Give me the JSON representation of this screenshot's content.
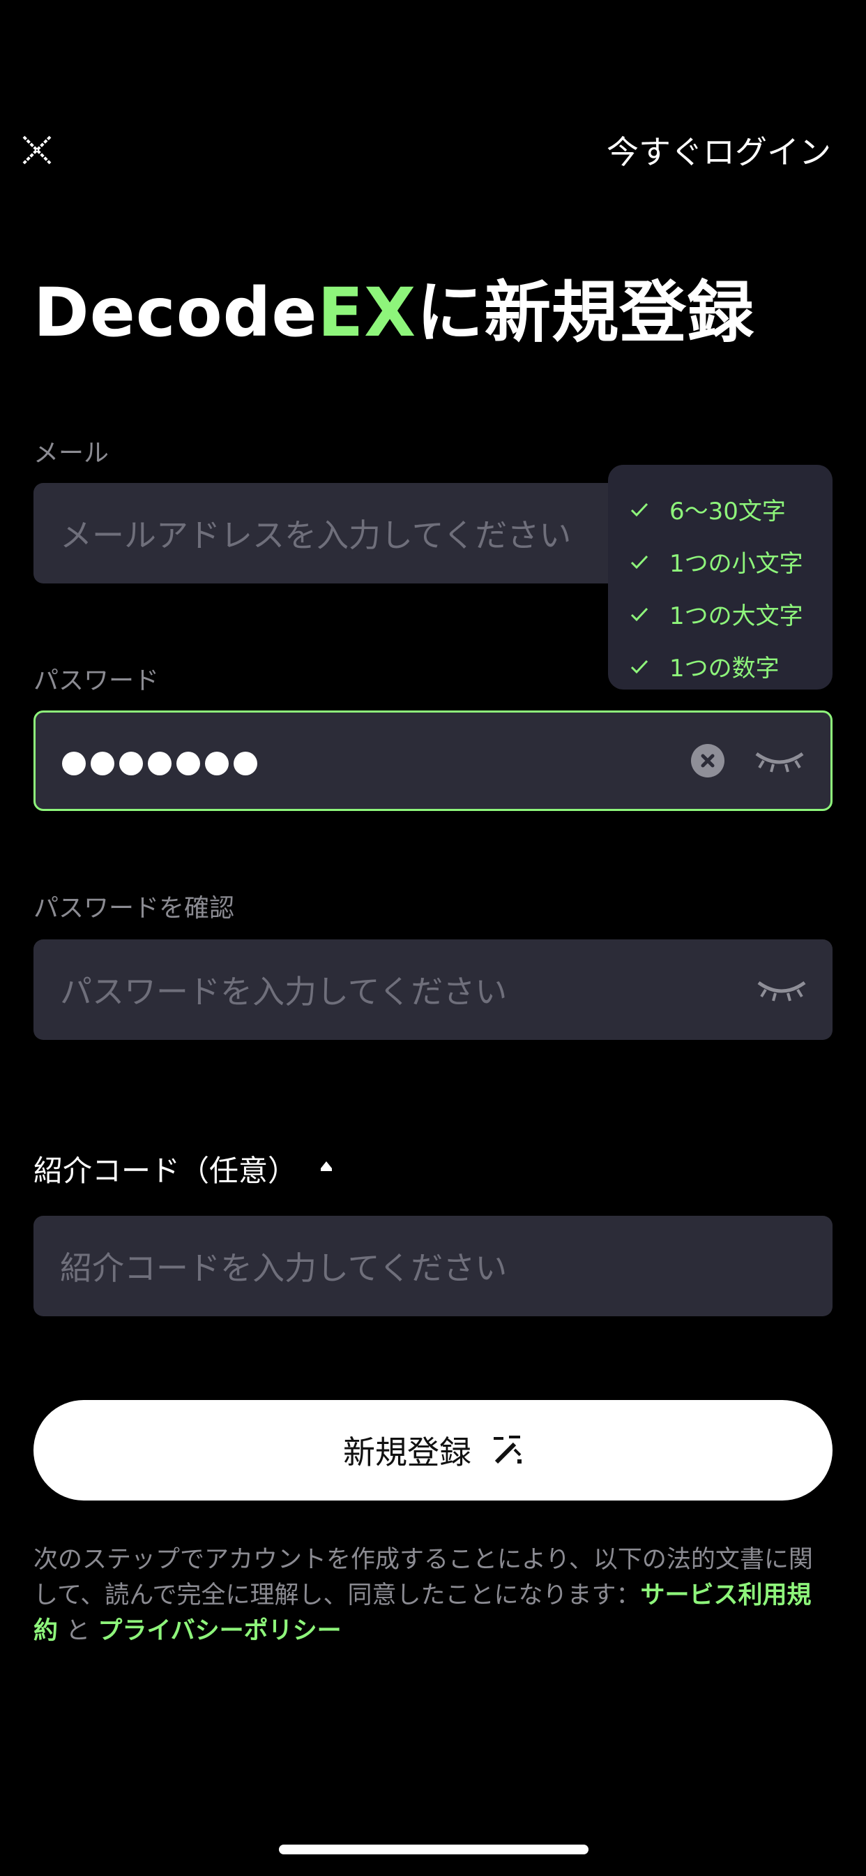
{
  "header": {
    "close_icon": "close-icon",
    "login_label": "今すぐログイン"
  },
  "title": {
    "brand_part1": "Decode",
    "brand_part2": "EX",
    "rest": "に新規登録",
    "accent_color": "#8ef57b"
  },
  "email": {
    "label": "メール",
    "placeholder": "メールアドレスを入力してください"
  },
  "password": {
    "label": "パスワード",
    "masked_length": 7,
    "rules": [
      {
        "text": "6～30文字",
        "met": true
      },
      {
        "text": "1つの小文字",
        "met": true
      },
      {
        "text": "1つの大文字",
        "met": true
      },
      {
        "text": "1つの数字",
        "met": true
      }
    ]
  },
  "confirm": {
    "label": "パスワードを確認",
    "placeholder": "パスワードを入力してください"
  },
  "referral": {
    "label": "紹介コード（任意）",
    "placeholder": "紹介コードを入力してください"
  },
  "signup": {
    "label": "新規登録",
    "icon": "magic-wand-icon"
  },
  "legal": {
    "text": "次のステップでアカウントを作成することにより、以下の法的文書に関して、読んで完全に理解し、同意したことになります：",
    "terms": "サービス利用規約",
    "and": "と",
    "privacy": "プライバシーポリシー"
  }
}
